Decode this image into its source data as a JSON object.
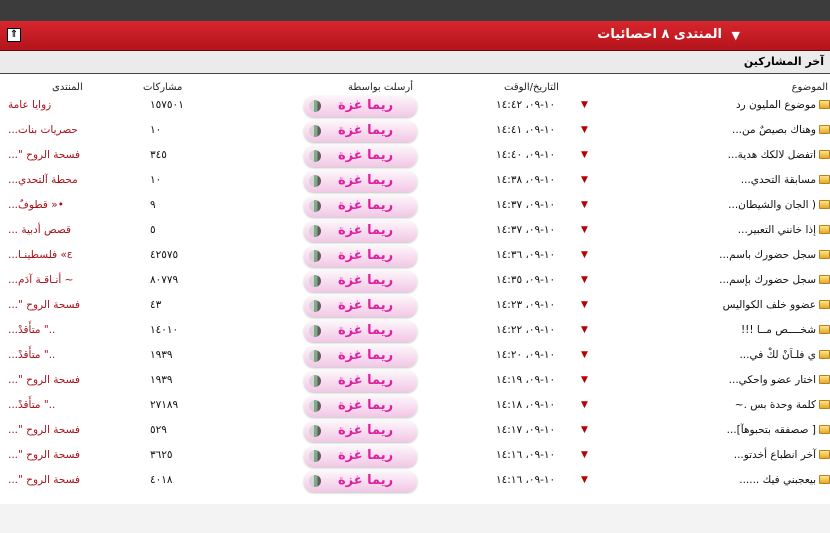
{
  "header": {
    "title": "المنتدى ٨ احصائيات",
    "collapse_label": "⇑"
  },
  "section": {
    "title": "آخر المشاركين"
  },
  "columns": {
    "topic": "الموضوع",
    "date": "التاريخ/الوقت",
    "poster": "أرسلت بواسطة",
    "posts": "مشاركات",
    "forum": "المنتدى"
  },
  "rows": [
    {
      "topic": "موضوع المليون رد",
      "date": "١٠-٠٩، ١٤:٤٢",
      "poster": "ريما غزة",
      "posts": "١٥٧٥٠١",
      "forum": "زوايا عامة"
    },
    {
      "topic": "وهناك بصيصٌ من...",
      "date": "١٠-٠٩، ١٤:٤١",
      "poster": "ريما غزة",
      "posts": "١٠",
      "forum": "حصريات بنات..."
    },
    {
      "topic": "اتفضل لالكك هدية...",
      "date": "١٠-٠٩، ١٤:٤٠",
      "poster": "ريما غزة",
      "posts": "٣٤٥",
      "forum": "فسحة الروح \"..."
    },
    {
      "topic": "مسابقة التحدي...",
      "date": "١٠-٠٩، ١٤:٣٨",
      "poster": "ريما غزة",
      "posts": "١٠",
      "forum": "محطة آلتحدي..."
    },
    {
      "topic": "( الجان والشيطان...",
      "date": "١٠-٠٩، ١٤:٣٧",
      "poster": "ريما غزة",
      "posts": "٩",
      "forum": "•« قطوفٌ..."
    },
    {
      "topic": "إذا خانني التعبير...",
      "date": "١٠-٠٩، ١٤:٣٧",
      "poster": "ريما غزة",
      "posts": "٥",
      "forum": "قصص أدبية ..."
    },
    {
      "topic": "سجل حضورك باسم...",
      "date": "١٠-٠٩، ١٤:٣٦",
      "poster": "ريما غزة",
      "posts": "٤٢٥٧٥",
      "forum": "ε» فلسطينـا..."
    },
    {
      "topic": "سجل حضورك بإسم...",
      "date": "١٠-٠٩، ١٤:٣٥",
      "poster": "ريما غزة",
      "posts": "٨٠٧٧٩",
      "forum": "~ أنـاقـة آدَم..."
    },
    {
      "topic": "عضوو خلف الكواليس",
      "date": "١٠-٠٩، ١٤:٢٣",
      "poster": "ريما غزة",
      "posts": "٤٣",
      "forum": "فسحة الروح \"..."
    },
    {
      "topic": "شخــــص مــا !!!",
      "date": "١٠-٠٩، ١٤:٢٢",
      "poster": "ريما غزة",
      "posts": "١٤٠١٠",
      "forum": "..\" متأَقدْ..."
    },
    {
      "topic": "ي فلـاَنْ لكْ في...",
      "date": "١٠-٠٩، ١٤:٢٠",
      "poster": "ريما غزة",
      "posts": "١٩٣٩",
      "forum": "..\" متأَقدْ..."
    },
    {
      "topic": "اختار عضو واحكي...",
      "date": "١٠-٠٩، ١٤:١٩",
      "poster": "ريما غزة",
      "posts": "١٩٣٩",
      "forum": "فسحة الروح \"..."
    },
    {
      "topic": "كلمة وحدة بس .~",
      "date": "١٠-٠٩، ١٤:١٨",
      "poster": "ريما غزة",
      "posts": "٢٧١٨٩",
      "forum": "..\" متأَقدْ..."
    },
    {
      "topic": "[ صصفقه بتحبوهآ]...",
      "date": "١٠-٠٩، ١٤:١٧",
      "poster": "ريما غزة",
      "posts": "٥٢٩",
      "forum": "فسحة الروح \"..."
    },
    {
      "topic": "آخر انطباع أخدتو...",
      "date": "١٠-٠٩، ١٤:١٦",
      "poster": "ريما غزة",
      "posts": "٣٦٢٥",
      "forum": "فسحة الروح \"..."
    },
    {
      "topic": "بيعجبني فيك ......",
      "date": "١٠-٠٩، ١٤:١٦",
      "poster": "ريما غزة",
      "posts": "٤٠١٨",
      "forum": "فسحة الروح \"..."
    }
  ],
  "colors": {
    "header": "#c41d24",
    "poster_text": "#e01fa0",
    "forum_text": "#a8101a"
  },
  "icons": {
    "row_icon": "folder-icon",
    "sort_icon": "triangle-down-icon",
    "collapse_icon": "collapse-up-icon"
  }
}
